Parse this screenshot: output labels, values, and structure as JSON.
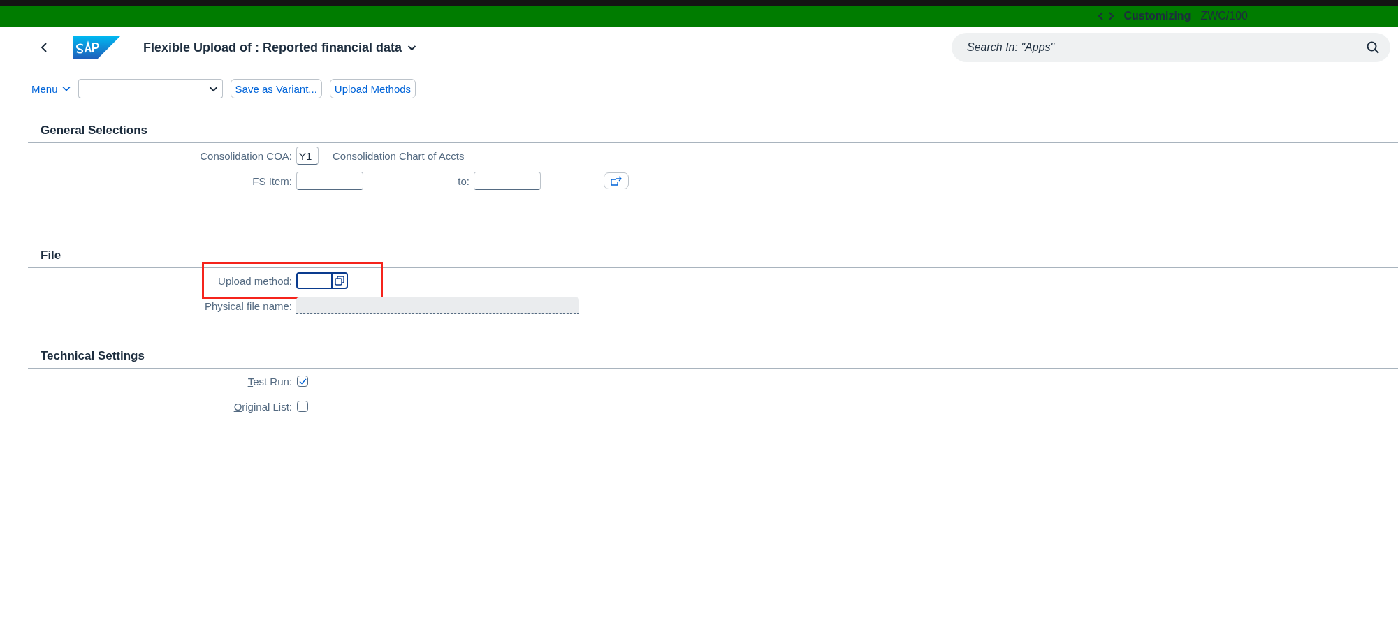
{
  "shell": {
    "title": "Customizing",
    "system": "ZWC/100"
  },
  "header": {
    "title": "Flexible Upload of : Reported financial data",
    "search": {
      "placeholder": "Search In: \"Apps\""
    }
  },
  "toolbar": {
    "menu": "Menu",
    "buttons": [
      "Save as Variant...",
      "Upload Methods"
    ]
  },
  "sections": [
    {
      "title": "General Selections",
      "rows": [
        {
          "kind": "input",
          "label": "Consolidation COA:",
          "value": "Y1",
          "description": "Consolidation Chart of Accts"
        },
        {
          "kind": "range",
          "label": "FS Item:",
          "to_label": "to:"
        }
      ]
    },
    {
      "title": "File",
      "rows": [
        {
          "kind": "f4",
          "label": "Upload method:",
          "highlighted": true,
          "focused": true
        },
        {
          "kind": "readonly",
          "label": "Physical file name:"
        }
      ]
    },
    {
      "title": "Technical Settings",
      "rows": [
        {
          "kind": "checkbox",
          "label": "Test Run:",
          "checked": true
        },
        {
          "kind": "checkbox",
          "label": "Original List:",
          "checked": false
        }
      ]
    }
  ]
}
